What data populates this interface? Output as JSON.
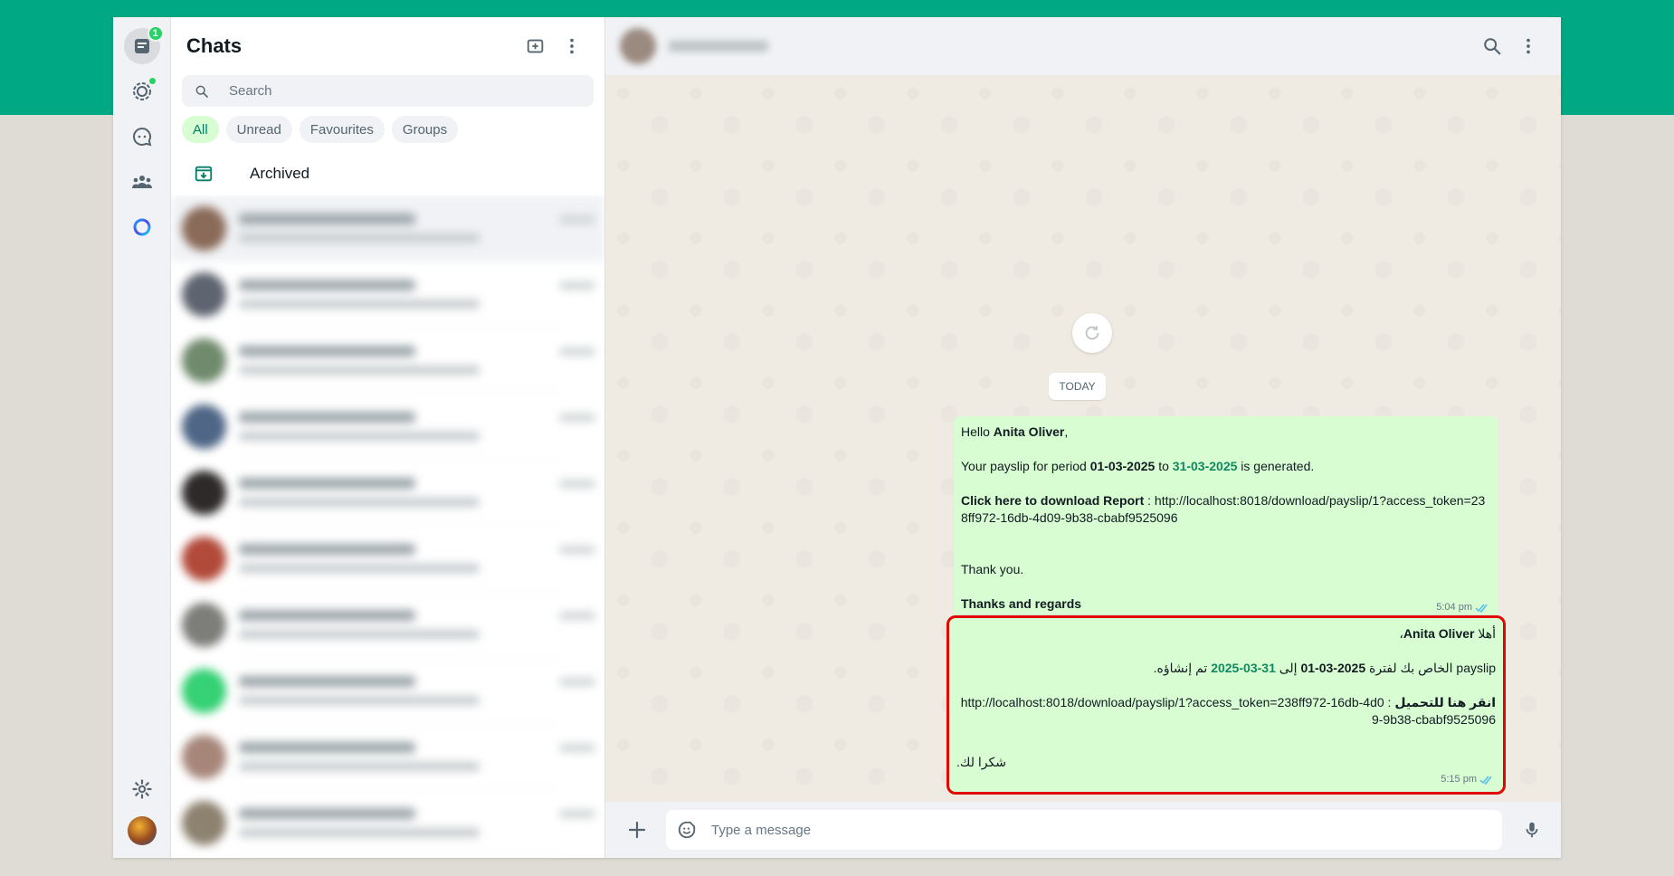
{
  "colors": {
    "brand": "#00a884",
    "bubble": "#d9fdd3",
    "highlight": "#e10600"
  },
  "rail": {
    "chats_badge": "1",
    "icons": [
      "chats-icon",
      "status-icon",
      "channels-icon",
      "communities-icon",
      "meta-ai-icon",
      "settings-icon"
    ]
  },
  "chatlist": {
    "title": "Chats",
    "search_placeholder": "Search",
    "filters": [
      "All",
      "Unread",
      "Favourites",
      "Groups"
    ],
    "archived_label": "Archived"
  },
  "conversation": {
    "date_divider": "TODAY",
    "message1": {
      "greeting": "Hello ",
      "name": "Anita Oliver",
      "comma": ",",
      "period_pre": "Your payslip for period ",
      "start_date": "01-03-2025",
      "to": " to ",
      "end_date": "31-03-2025",
      "period_post": " is generated.",
      "download_label": "Click here to download Report",
      "download_sep": " : ",
      "link": "http://localhost:8018/download/payslip/1?access_token=238ff972-16db-4d09-9b38-cbabf9525096",
      "thanks": "Thank you.",
      "regards": "Thanks and regards",
      "time": "5:04 pm"
    },
    "message2": {
      "greeting": "أهلا ",
      "name": "Anita Oliver",
      "comma": "،",
      "period_pre": "payslip الخاص بك لفترة ",
      "start_date": "2025-03-01",
      "to": " إلى ",
      "end_date": "31-03-2025",
      "period_post": " تم إنشاؤه.",
      "download_label": "انقر هنا للتحميل",
      "download_sep": " : ",
      "link": "http://localhost:8018/download/payslip/1?access_token=238ff972-16db-4d09-9b38-cbabf9525096",
      "thanks": "شكرا لك.",
      "time": "5:15 pm"
    }
  },
  "composer": {
    "placeholder": "Type a message"
  }
}
